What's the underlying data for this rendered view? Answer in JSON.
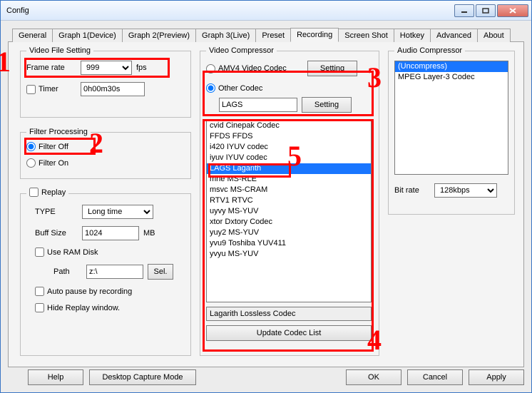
{
  "window": {
    "title": "Config"
  },
  "tabs": [
    "General",
    "Graph 1(Device)",
    "Graph 2(Preview)",
    "Graph 3(Live)",
    "Preset",
    "Recording",
    "Screen Shot",
    "Hotkey",
    "Advanced",
    "About"
  ],
  "active_tab_index": 5,
  "video_file_setting": {
    "legend": "Video File Setting",
    "frame_rate_label": "Frame rate",
    "frame_rate_value": "999",
    "frame_rate_unit": "fps",
    "timer_label": "Timer",
    "timer_checked": false,
    "timer_value": "0h00m30s"
  },
  "filter_processing": {
    "legend": "Filter Processing",
    "off_label": "Filter Off",
    "on_label": "Filter On",
    "selected": "off"
  },
  "replay": {
    "checked": false,
    "label": "Replay",
    "type_label": "TYPE",
    "type_value": "Long time",
    "buff_label": "Buff Size",
    "buff_value": "1024",
    "buff_unit": "MB",
    "ramdisk_label": "Use RAM Disk",
    "ramdisk_checked": false,
    "path_label": "Path",
    "path_value": "z:\\",
    "sel_button": "Sel.",
    "autopause_label": "Auto pause by recording",
    "autopause_checked": false,
    "hidewin_label": "Hide Replay window.",
    "hidewin_checked": false
  },
  "video_compressor": {
    "legend": "Video Compressor",
    "amv4_label": "AMV4 Video Codec",
    "amv4_selected": false,
    "setting_button": "Setting",
    "other_label": "Other Codec",
    "other_selected": true,
    "other_value": "LAGS",
    "list": [
      "cvid   Cinepak Codec",
      "FFDS   FFDS",
      "i420   IYUV codec",
      "iyuv   IYUV codec",
      "LAGS   Lagarith",
      "mrle   MS-RLE",
      "msvc   MS-CRAM",
      "RTV1   RTVC",
      "uyvy   MS-YUV",
      "xtor   Dxtory Codec",
      "yuy2   MS-YUV",
      "yvu9   Toshiba YUV411",
      "yvyu   MS-YUV"
    ],
    "selected_index": 4,
    "selected_codec_full": "Lagarith Lossless Codec",
    "update_button": "Update Codec List"
  },
  "audio_compressor": {
    "legend": "Audio Compressor",
    "list": [
      "(Uncompress)",
      "MPEG Layer-3 Codec"
    ],
    "selected_index": 0,
    "bitrate_label": "Bit rate",
    "bitrate_value": "128kbps"
  },
  "bottom": {
    "help": "Help",
    "desktop": "Desktop Capture Mode",
    "ok": "OK",
    "cancel": "Cancel",
    "apply": "Apply"
  },
  "annotations": {
    "n1": "1",
    "n2": "2",
    "n3": "3",
    "n4": "4",
    "n5": "5"
  }
}
